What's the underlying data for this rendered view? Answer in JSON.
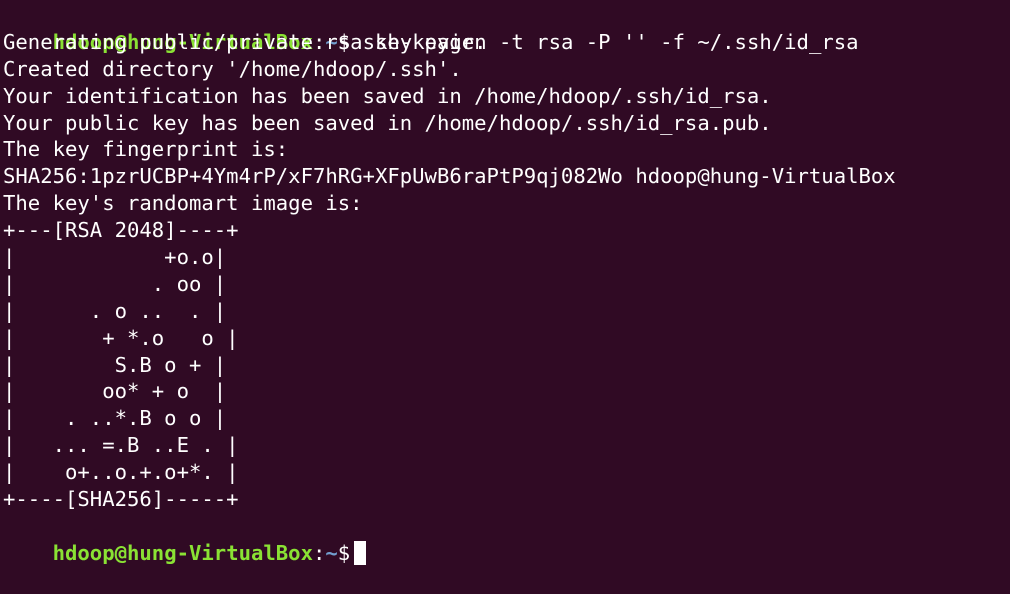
{
  "colors": {
    "background": "#300a24",
    "foreground": "#ffffff",
    "prompt_user": "#8ae234",
    "prompt_path": "#729fcf"
  },
  "prompt": {
    "user_host": "hdoop@hung-VirtualBox",
    "separator": ":",
    "path": "~",
    "symbol": "$"
  },
  "command": " ssh-keygen -t rsa -P '' -f ~/.ssh/id_rsa",
  "output": [
    "Generating public/private rsa key pair.",
    "Created directory '/home/hdoop/.ssh'.",
    "Your identification has been saved in /home/hdoop/.ssh/id_rsa.",
    "Your public key has been saved in /home/hdoop/.ssh/id_rsa.pub.",
    "The key fingerprint is:",
    "SHA256:1pzrUCBP+4Ym4rP/xF7hRG+XFpUwB6raPtP9qj082Wo hdoop@hung-VirtualBox",
    "The key's randomart image is:",
    "+---[RSA 2048]----+",
    "|            +o.o|",
    "|           . oo |",
    "|      . o ..  . |",
    "|       + *.o   o |",
    "|        S.B o + |",
    "|       oo* + o  |",
    "|    . ..*.B o o |",
    "|   ... =.B ..E . |",
    "|    o+..o.+.o+*. |",
    "+----[SHA256]-----+"
  ]
}
